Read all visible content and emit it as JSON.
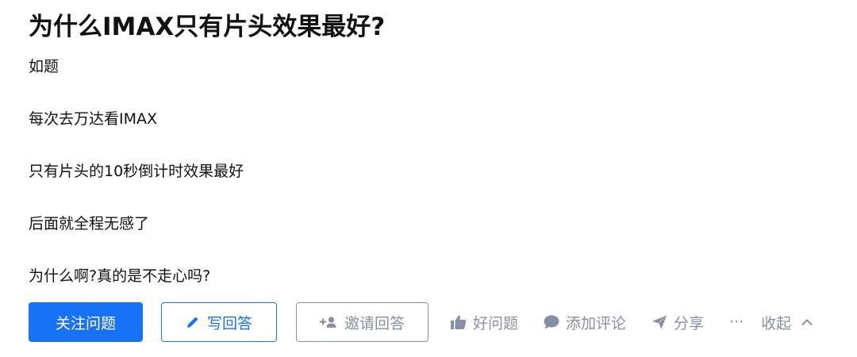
{
  "question": {
    "title": "为什么IMAX只有片头效果最好?",
    "detail": [
      "如题",
      "每次去万达看IMAX",
      "只有片头的10秒倒计时效果最好",
      "后面就全程无感了",
      "为什么啊?真的是不走心吗?"
    ]
  },
  "actions": {
    "follow_label": "关注问题",
    "write_label": "写回答",
    "invite_label": "邀请回答",
    "good_question_label": "好问题",
    "comment_label": "添加评论",
    "share_label": "分享",
    "more_label": "···",
    "collapse_label": "收起"
  },
  "colors": {
    "primary": "#1772f6",
    "muted": "#8590a6",
    "text": "#121212"
  },
  "icons": {
    "write": "pencil-icon",
    "invite": "add-user-icon",
    "good_question": "thumbs-up-icon",
    "comment": "comment-icon",
    "share": "paper-plane-icon",
    "collapse": "chevron-up-icon"
  }
}
